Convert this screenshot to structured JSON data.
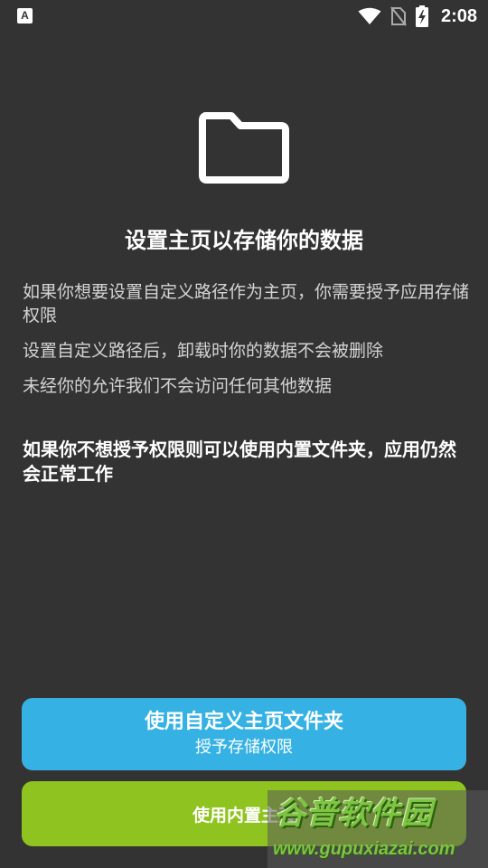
{
  "status_bar": {
    "left_icon_letter": "A",
    "time": "2:08",
    "icons": [
      "wifi-icon",
      "no-sim-icon",
      "battery-charging-icon"
    ]
  },
  "icon": {
    "name": "folder-icon"
  },
  "title": "设置主页以存储你的数据",
  "info_items": [
    "如果你想要设置自定义路径作为主页，你需要授予应用存储权限",
    "设置自定义路径后，卸载时你的数据不会被删除",
    "未经你的允许我们不会访问任何其他数据"
  ],
  "notice": "如果你不想授予权限则可以使用内置文件夹，应用仍然会正常工作",
  "buttons": {
    "custom": {
      "label": "使用自定义主页文件夹",
      "sublabel": "授予存储权限",
      "color": "#35b2e3"
    },
    "builtin": {
      "label": "使用内置主页",
      "color": "#8fc31f"
    }
  },
  "watermark": {
    "title": "谷普软件园",
    "url": "www.gupuxiazai.com"
  },
  "colors": {
    "background": "#333333",
    "text_primary": "#ffffff",
    "text_secondary": "#d4d4d4"
  }
}
